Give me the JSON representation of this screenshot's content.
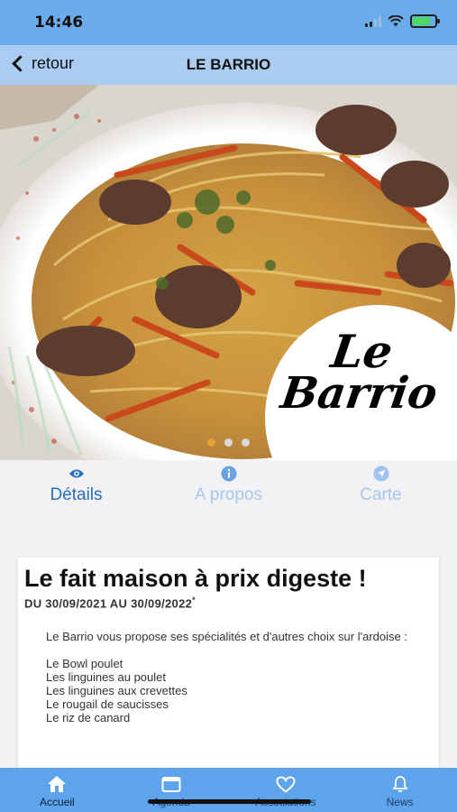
{
  "status": {
    "time": "14:46",
    "battery_level": 0.8
  },
  "nav": {
    "back_label": "retour",
    "title": "LE BARRIO"
  },
  "hero": {
    "logo_line1": "Le",
    "logo_line2": "Barrio",
    "page_count": 3,
    "active_page": 1
  },
  "tabs": [
    {
      "label": "Détails",
      "icon": "eye-icon",
      "active": true
    },
    {
      "label": "A propos",
      "icon": "info-icon",
      "active": false
    },
    {
      "label": "Carte",
      "icon": "location-arrow-icon",
      "active": false
    }
  ],
  "event": {
    "title": "Le fait maison à prix digeste !",
    "dates": "DU 30/09/2021 AU 30/09/2022",
    "dates_mark": "*",
    "intro": "Le Barrio vous propose ses spécialités et d'autres choix sur l'ardoise :",
    "items": [
      "Le Bowl poulet",
      "Les linguines au poulet",
      "Les linguines aux crevettes",
      "Le rougail de saucisses",
      "Le riz de canard"
    ]
  },
  "tabbar": [
    {
      "label": "Accueil",
      "icon": "home-icon",
      "active": true
    },
    {
      "label": "Agenda",
      "icon": "calendar-icon",
      "active": false
    },
    {
      "label": "Associations",
      "icon": "heart-icon",
      "active": false
    },
    {
      "label": "News",
      "icon": "bell-icon",
      "active": false
    }
  ],
  "colors": {
    "status_bar": "#6aabec",
    "nav_bar": "#a9ccf0",
    "tab_active": "#2a6dc0",
    "tab_inactive": "#a7c7ea",
    "tabbar": "#5ea4ec",
    "carousel_dot_active": "#e3a132"
  }
}
